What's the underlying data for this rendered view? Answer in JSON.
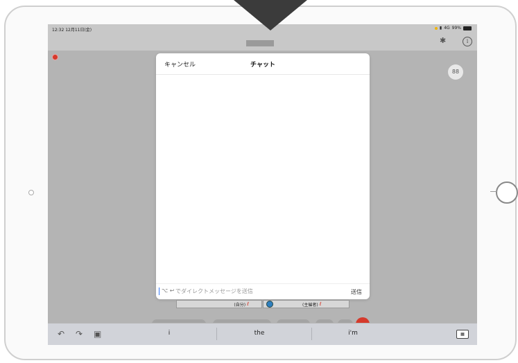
{
  "status_bar": {
    "time": "12:32  12月11日(金)",
    "network": "4G",
    "battery": "99%"
  },
  "topbar": {
    "bluetooth_icon": "bluetooth-icon",
    "info_icon": "i"
  },
  "gallery_button": "88",
  "chat": {
    "cancel_label": "キャンセル",
    "title": "チャット",
    "input_placeholder": "でダイレクトメッセージを送信",
    "input_prefix": "⌥ ↩",
    "send_label": "送信"
  },
  "participants": {
    "self_label": "(自分)",
    "host_label": "(主催者)"
  },
  "keyboard_bar": {
    "suggestions": [
      "i",
      "the",
      "i'm"
    ]
  },
  "colors": {
    "record_dot": "#d53a2c",
    "caret": "#3478f6",
    "pointer": "#3b3b3b"
  }
}
